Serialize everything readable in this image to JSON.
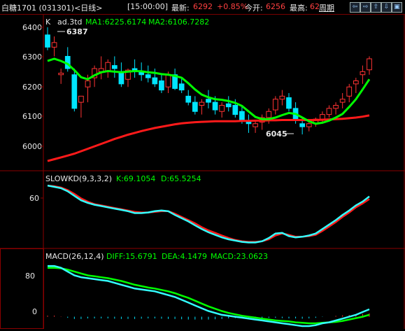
{
  "header": {
    "title": "白糖1701 (031301)<日线>",
    "time": "[15:00:00]",
    "latest_label": "最新:",
    "latest_value": "6292",
    "change": "+0.85%",
    "open_label": "今开:",
    "open_value": "6256",
    "high_label": "最高:",
    "high_value": "62",
    "cycle_label": "周期"
  },
  "toolbar": [
    "⇦",
    "⇨",
    "⇧",
    "⇩",
    "▣"
  ],
  "colors": {
    "up": "#ff3333",
    "down": "#00e5ff",
    "ma1": "#00ff00",
    "ma2": "#ff1a1a",
    "signal_up": "#ff6600",
    "signal_down": "#44cc44",
    "grid": "#8b0000",
    "text": "#e8e8e8"
  },
  "panes": {
    "price": {
      "label": "K",
      "indicator_name": "ad.3td",
      "ma1": "MA1:6225.6174",
      "ma2": "MA2:6106.7282",
      "y_ticks": [
        "6400",
        "6300",
        "6200",
        "6100",
        "6000"
      ],
      "high_marker": "6387",
      "low_marker": "6045"
    },
    "kd": {
      "label": "SLOWKD(9,3,3,2)",
      "k": "K:69.1054",
      "d": "D:65.5254",
      "y_ticks": [
        "60"
      ]
    },
    "macd": {
      "label": "MACD(26,12,4)",
      "diff": "DIFF:15.6791",
      "dea": "DEA:4.1479",
      "macd": "MACD:23.0623",
      "y_ticks": [
        "80",
        "0"
      ]
    }
  },
  "chart_data": [
    {
      "type": "candlestick",
      "ylim": [
        5940,
        6420
      ],
      "candles": [
        [
          6370,
          6395,
          6320,
          6330
        ],
        [
          6330,
          6365,
          6300,
          6345
        ],
        [
          6240,
          6260,
          6210,
          6245
        ],
        [
          6300,
          6330,
          6250,
          6260
        ],
        [
          6240,
          6260,
          6120,
          6130
        ],
        [
          6150,
          6170,
          6100,
          6170
        ],
        [
          6200,
          6240,
          6150,
          6220
        ],
        [
          6230,
          6270,
          6200,
          6260
        ],
        [
          6250,
          6300,
          6225,
          6260
        ],
        [
          6250,
          6290,
          6230,
          6280
        ],
        [
          6270,
          6300,
          6230,
          6260
        ],
        [
          6250,
          6280,
          6200,
          6210
        ],
        [
          6225,
          6260,
          6200,
          6255
        ],
        [
          6260,
          6290,
          6230,
          6250
        ],
        [
          6250,
          6280,
          6220,
          6240
        ],
        [
          6240,
          6270,
          6215,
          6230
        ],
        [
          6230,
          6260,
          6200,
          6210
        ],
        [
          6220,
          6240,
          6180,
          6190
        ],
        [
          6200,
          6250,
          6180,
          6240
        ],
        [
          6240,
          6260,
          6190,
          6195
        ],
        [
          6210,
          6230,
          6180,
          6190
        ],
        [
          6170,
          6190,
          6140,
          6150
        ],
        [
          6150,
          6170,
          6110,
          6120
        ],
        [
          6140,
          6160,
          6110,
          6150
        ],
        [
          6160,
          6190,
          6130,
          6150
        ],
        [
          6150,
          6170,
          6110,
          6125
        ],
        [
          6120,
          6150,
          6100,
          6140
        ],
        [
          6145,
          6170,
          6120,
          6135
        ],
        [
          6140,
          6160,
          6100,
          6110
        ],
        [
          6120,
          6140,
          6080,
          6090
        ],
        [
          6090,
          6110,
          6050,
          6080
        ],
        [
          6070,
          6090,
          6050,
          6080
        ],
        [
          6085,
          6110,
          6060,
          6100
        ],
        [
          6100,
          6130,
          6080,
          6120
        ],
        [
          6125,
          6170,
          6110,
          6160
        ],
        [
          6160,
          6190,
          6140,
          6170
        ],
        [
          6165,
          6180,
          6120,
          6130
        ],
        [
          6130,
          6150,
          6080,
          6090
        ],
        [
          6080,
          6100,
          6045,
          6070
        ],
        [
          6070,
          6090,
          6055,
          6080
        ],
        [
          6080,
          6100,
          6070,
          6095
        ],
        [
          6095,
          6120,
          6080,
          6110
        ],
        [
          6110,
          6140,
          6100,
          6130
        ],
        [
          6130,
          6150,
          6110,
          6140
        ],
        [
          6150,
          6180,
          6130,
          6160
        ],
        [
          6170,
          6210,
          6150,
          6200
        ],
        [
          6210,
          6230,
          6180,
          6220
        ],
        [
          6240,
          6270,
          6210,
          6250
        ],
        [
          6256,
          6300,
          6240,
          6292
        ]
      ],
      "ma1": [
        6285,
        6292,
        6285,
        6275,
        6255,
        6232,
        6225,
        6238,
        6248,
        6252,
        6250,
        6248,
        6250,
        6252,
        6251,
        6248,
        6246,
        6242,
        6240,
        6236,
        6230,
        6212,
        6192,
        6175,
        6166,
        6160,
        6158,
        6154,
        6148,
        6138,
        6120,
        6102,
        6095,
        6095,
        6100,
        6108,
        6115,
        6112,
        6100,
        6088,
        6080,
        6083,
        6090,
        6100,
        6112,
        6135,
        6160,
        6192,
        6225
      ],
      "ma2": [
        5958,
        5964,
        5970,
        5976,
        5982,
        5990,
        5998,
        6006,
        6014,
        6022,
        6030,
        6037,
        6044,
        6050,
        6056,
        6061,
        6066,
        6070,
        6074,
        6078,
        6081,
        6083,
        6085,
        6086,
        6087,
        6088,
        6088,
        6088,
        6088,
        6089,
        6089,
        6090,
        6090,
        6091,
        6091,
        6092,
        6092,
        6092,
        6092,
        6092,
        6092,
        6093,
        6094,
        6095,
        6096,
        6098,
        6100,
        6103,
        6107
      ]
    },
    {
      "type": "line",
      "ylim": [
        0,
        100
      ],
      "series": [
        {
          "name": "K",
          "values": [
            95,
            93,
            91,
            86,
            79,
            72,
            68,
            65,
            63,
            61,
            59,
            57,
            55,
            52,
            52,
            53,
            55,
            56,
            55,
            49,
            44,
            39,
            33,
            27,
            22,
            18,
            14,
            11,
            9,
            7,
            6,
            6,
            8,
            13,
            20,
            21,
            16,
            14,
            15,
            17,
            20,
            27,
            34,
            41,
            49,
            56,
            64,
            70,
            78
          ]
        },
        {
          "name": "D",
          "values": [
            95,
            94,
            92,
            88,
            82,
            75,
            70,
            66,
            64,
            62,
            60,
            58,
            56,
            54,
            53,
            53,
            54,
            55,
            55,
            51,
            46,
            41,
            36,
            30,
            25,
            21,
            17,
            13,
            10,
            8,
            7,
            7,
            8,
            11,
            17,
            20,
            18,
            15,
            15,
            16,
            18,
            24,
            31,
            38,
            46,
            53,
            61,
            67,
            74
          ]
        }
      ]
    },
    {
      "type": "line",
      "ylim": [
        -20,
        120
      ],
      "series": [
        {
          "name": "DIFF",
          "values": [
            108,
            108,
            104,
            96,
            88,
            84,
            82,
            80,
            78,
            76,
            72,
            68,
            64,
            60,
            58,
            56,
            54,
            50,
            46,
            42,
            36,
            30,
            24,
            18,
            12,
            8,
            4,
            2,
            0,
            -2,
            -4,
            -6,
            -8,
            -10,
            -12,
            -14,
            -16,
            -18,
            -20,
            -20,
            -18,
            -14,
            -12,
            -8,
            -4,
            0,
            4,
            10,
            15.6791
          ]
        },
        {
          "name": "DEA",
          "values": [
            104,
            104,
            103,
            100,
            96,
            92,
            88,
            86,
            84,
            82,
            79,
            76,
            72,
            68,
            65,
            62,
            60,
            57,
            54,
            50,
            45,
            40,
            34,
            28,
            22,
            17,
            12,
            8,
            5,
            2,
            0,
            -2,
            -4,
            -6,
            -8,
            -9,
            -10,
            -12,
            -13,
            -14,
            -14,
            -13,
            -12,
            -11,
            -9,
            -6,
            -3,
            0,
            4.1479
          ]
        }
      ]
    }
  ]
}
